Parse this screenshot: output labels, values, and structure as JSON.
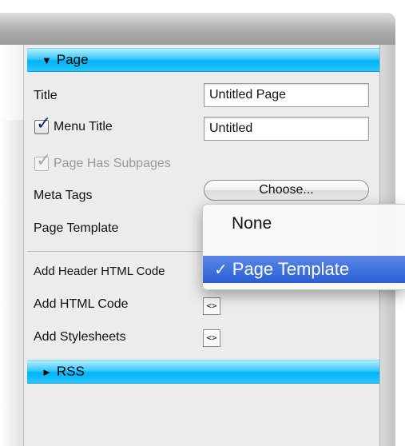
{
  "sections": {
    "page": {
      "label": "Page"
    },
    "rss": {
      "label": "RSS"
    }
  },
  "fields": {
    "title": {
      "label": "Title",
      "value": "Untitled Page"
    },
    "menu_title": {
      "label": "Menu Title",
      "value": "Untitled",
      "checked": true
    },
    "subpages": {
      "label": "Page Has Subpages",
      "checked": true,
      "disabled": true
    },
    "meta_tags": {
      "label": "Meta Tags",
      "button": "Choose..."
    },
    "page_template": {
      "label": "Page Template"
    }
  },
  "html_code": {
    "header": {
      "label": "Add Header HTML Code"
    },
    "code": {
      "label": "Add HTML Code",
      "button": "<>"
    },
    "stylesheets": {
      "label": "Add Stylesheets",
      "button": "<>"
    }
  },
  "dropdown": {
    "options": [
      "None",
      "Page Template"
    ],
    "selected": "Page Template"
  },
  "icons": {
    "expanded": "triangle-down-icon",
    "collapsed": "triangle-right-icon",
    "check": "checkmark-icon"
  }
}
